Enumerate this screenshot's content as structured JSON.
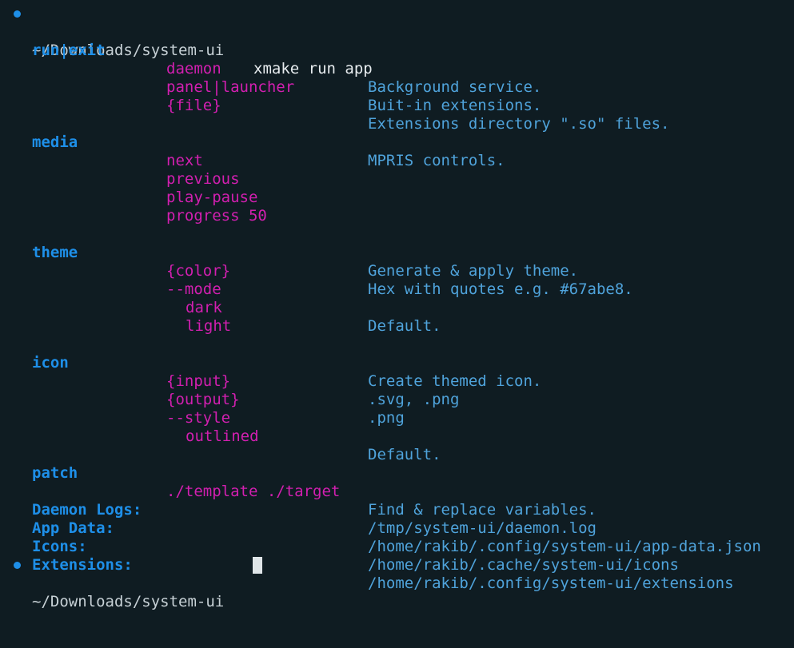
{
  "prompt": {
    "path": "~/Downloads/system-ui",
    "command": "xmake run app"
  },
  "help": {
    "run": {
      "cmd": "run|exit",
      "args": [
        {
          "name": "daemon",
          "desc": "Background service."
        },
        {
          "name": "panel|launcher",
          "desc": "Buit-in extensions."
        },
        {
          "name": "{file}",
          "desc": "Extensions directory \".so\" files."
        }
      ]
    },
    "media": {
      "cmd": "media",
      "desc": "MPRIS controls.",
      "args": [
        "next",
        "previous",
        "play-pause",
        "progress 50"
      ]
    },
    "theme": {
      "cmd": "theme",
      "desc": "Generate & apply theme.",
      "color_arg": "{color}",
      "color_desc": "Hex with quotes e.g. #67abe8.",
      "mode_flag": "--mode",
      "mode_dark": "dark",
      "mode_dark_desc": "Default.",
      "mode_light": "light"
    },
    "icon": {
      "cmd": "icon",
      "desc": "Create themed icon.",
      "input_arg": "{input}",
      "input_desc": ".svg, .png",
      "output_arg": "{output}",
      "output_desc": ".png",
      "style_flag": "--style",
      "style_outlined": "outlined",
      "style_outlined_desc": "Default."
    },
    "patch": {
      "cmd": "patch",
      "arg": "./template ./target",
      "desc": "Find & replace variables."
    }
  },
  "paths": [
    {
      "label": "Daemon Logs:",
      "value": "/tmp/system-ui/daemon.log"
    },
    {
      "label": "App Data:",
      "value": "/home/rakib/.config/system-ui/app-data.json"
    },
    {
      "label": "Icons:",
      "value": "/home/rakib/.cache/system-ui/icons"
    },
    {
      "label": "Extensions:",
      "value": "/home/rakib/.config/system-ui/extensions"
    }
  ],
  "colors": {
    "background": "#0f1c22",
    "command": "#1e8fe8",
    "argument": "#d21fb0",
    "description": "#4fa3db"
  }
}
